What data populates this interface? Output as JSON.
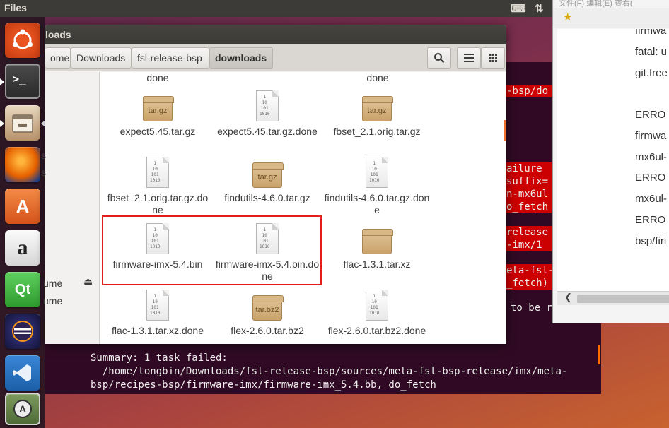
{
  "top_panel": {
    "app_title": "Files"
  },
  "launcher": {
    "items": [
      {
        "name": "dash",
        "glyph": "◉"
      },
      {
        "name": "terminal",
        "glyph": ">_"
      },
      {
        "name": "files",
        "glyph": "▤"
      },
      {
        "name": "firefox",
        "glyph": "●"
      },
      {
        "name": "software-center",
        "glyph": "A"
      },
      {
        "name": "amazon",
        "glyph": "a"
      },
      {
        "name": "qt-creator",
        "glyph": "Qt"
      },
      {
        "name": "eclipse",
        "glyph": "☰"
      },
      {
        "name": "vscode",
        "glyph": "⋈"
      },
      {
        "name": "updater",
        "glyph": "A"
      }
    ]
  },
  "files_window": {
    "title": "loads",
    "breadcrumbs": [
      "ome",
      "Downloads",
      "fsl-release-bsp",
      "downloads"
    ],
    "active_crumb": "downloads",
    "sidebar_items": [
      "s",
      "s",
      "ume",
      "ume"
    ],
    "items": [
      {
        "label": "done",
        "icon": "none"
      },
      {
        "label": "done",
        "icon": "none"
      },
      {
        "label": "expect5.45.tar.gz",
        "icon": "archive",
        "badge": "tar.gz"
      },
      {
        "label": "expect5.45.tar.gz.done",
        "icon": "document"
      },
      {
        "label": "fbset_2.1.orig.tar.gz",
        "icon": "archive",
        "badge": "tar.gz"
      },
      {
        "label": "fbset_2.1.orig.tar.gz.done",
        "icon": "document"
      },
      {
        "label": "findutils-4.6.0.tar.gz",
        "icon": "archive",
        "badge": "tar.gz"
      },
      {
        "label": "findutils-4.6.0.tar.gz.done",
        "icon": "document"
      },
      {
        "label": "firmware-imx-5.4.bin",
        "icon": "document"
      },
      {
        "label": "firmware-imx-5.4.bin.done",
        "icon": "document"
      },
      {
        "label": "flac-1.3.1.tar.xz",
        "icon": "archive",
        "badge": ""
      },
      {
        "label": "flac-1.3.1.tar.xz.done",
        "icon": "document"
      },
      {
        "label": "flex-2.6.0.tar.bz2",
        "icon": "archive",
        "badge": "tar.bz2"
      },
      {
        "label": "flex-2.6.0.tar.bz2.done",
        "icon": "document"
      }
    ]
  },
  "terminal": {
    "highlight_lines": [
      "-bsp/do",
      "ailure",
      "suffix=",
      "n-mx6ul",
      "o_fetch",
      "release",
      "-imx/1",
      "eta-fsl-",
      "_fetch)"
    ],
    "tail_fragment": "to be r",
    "summary_lines": [
      "Summary: 1 task failed:",
      "  /home/longbin/Downloads/fsl-release-bsp/sources/meta-fsl-bsp-release/imx/meta-",
      "bsp/recipes-bsp/firmware-imx/firmware-imx_5.4.bb, do_fetch"
    ]
  },
  "browser": {
    "menu_text": "文件(F)  编辑(E)  查看(",
    "lines": [
      "firmwa",
      "fatal: u",
      "git.free",
      "",
      "ERRO",
      "firmwa",
      "mx6ul-",
      "ERRO",
      "mx6ul-",
      "ERRO",
      "bsp/firi"
    ]
  },
  "colors": {
    "terminal_bg": "#300a24",
    "error_highlight": "#cc0000",
    "selection_box": "#e01e1e",
    "panel_bg": "#3c3b37"
  }
}
